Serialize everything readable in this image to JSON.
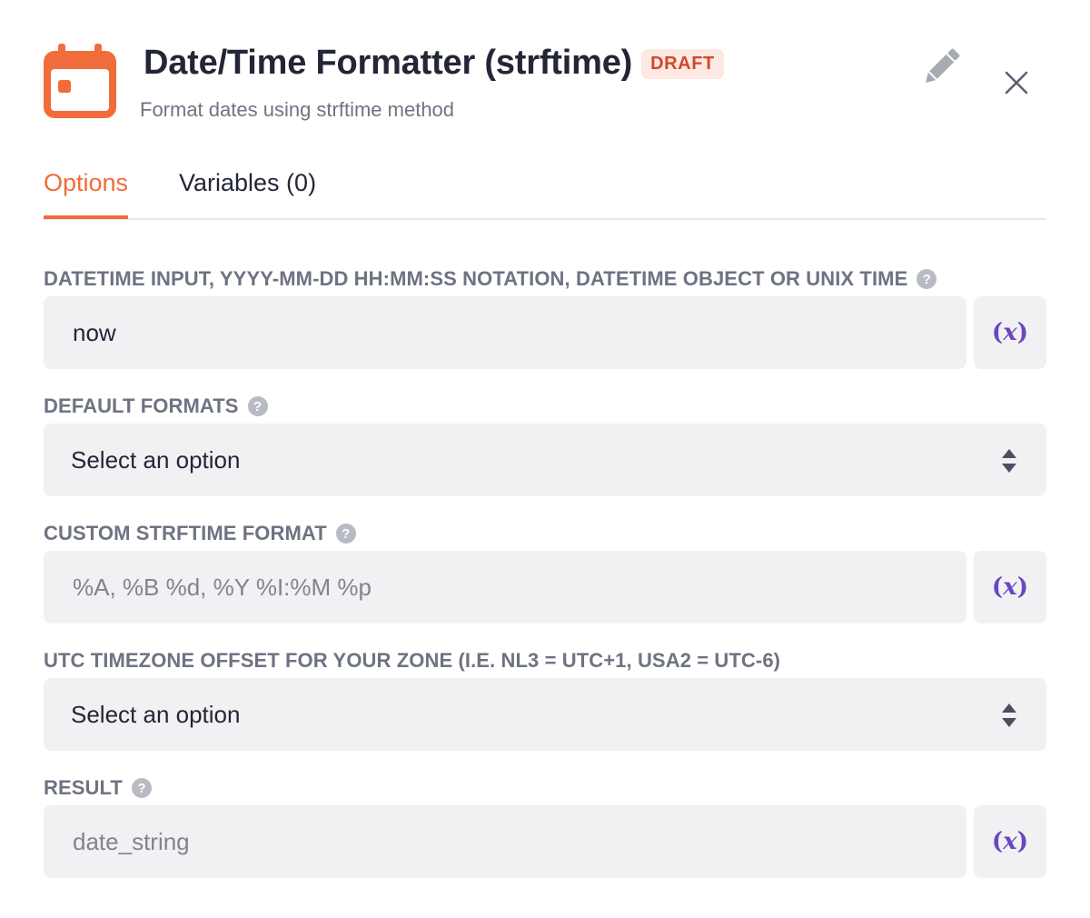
{
  "header": {
    "title": "Date/Time Formatter (strftime)",
    "badge": "DRAFT",
    "subtitle": "Format dates using strftime method",
    "app_icon": "calendar-icon",
    "edit_icon": "pencil-icon",
    "close_icon": "close-icon"
  },
  "tabs": [
    {
      "label": "Options",
      "active": true
    },
    {
      "label": "Variables (0)",
      "active": false
    }
  ],
  "fields": {
    "datetime_input": {
      "label": "DATETIME INPUT, YYYY-MM-DD HH:MM:SS NOTATION, DATETIME OBJECT OR UNIX TIME",
      "value": "now",
      "has_help": true
    },
    "default_formats": {
      "label": "DEFAULT FORMATS",
      "selected": "Select an option",
      "has_help": true
    },
    "custom_format": {
      "label": "CUSTOM STRFTIME FORMAT",
      "placeholder": "%A, %B %d, %Y %I:%M %p",
      "has_help": true
    },
    "utc_offset": {
      "label": "UTC TIMEZONE OFFSET FOR YOUR ZONE (I.E. NL3 = UTC+1, USA2 = UTC-6)",
      "selected": "Select an option",
      "has_help": false
    },
    "result": {
      "label": "RESULT",
      "placeholder": "date_string",
      "has_help": true
    }
  },
  "variable_button": {
    "open": "(",
    "symbol": "x",
    "close": ")"
  },
  "help_glyph": "?",
  "colors": {
    "accent": "#f26b3a",
    "badge_bg": "#fde8e3",
    "badge_text": "#cf4a26",
    "variable": "#6b46c1",
    "field_bg": "#f1f1f4"
  }
}
